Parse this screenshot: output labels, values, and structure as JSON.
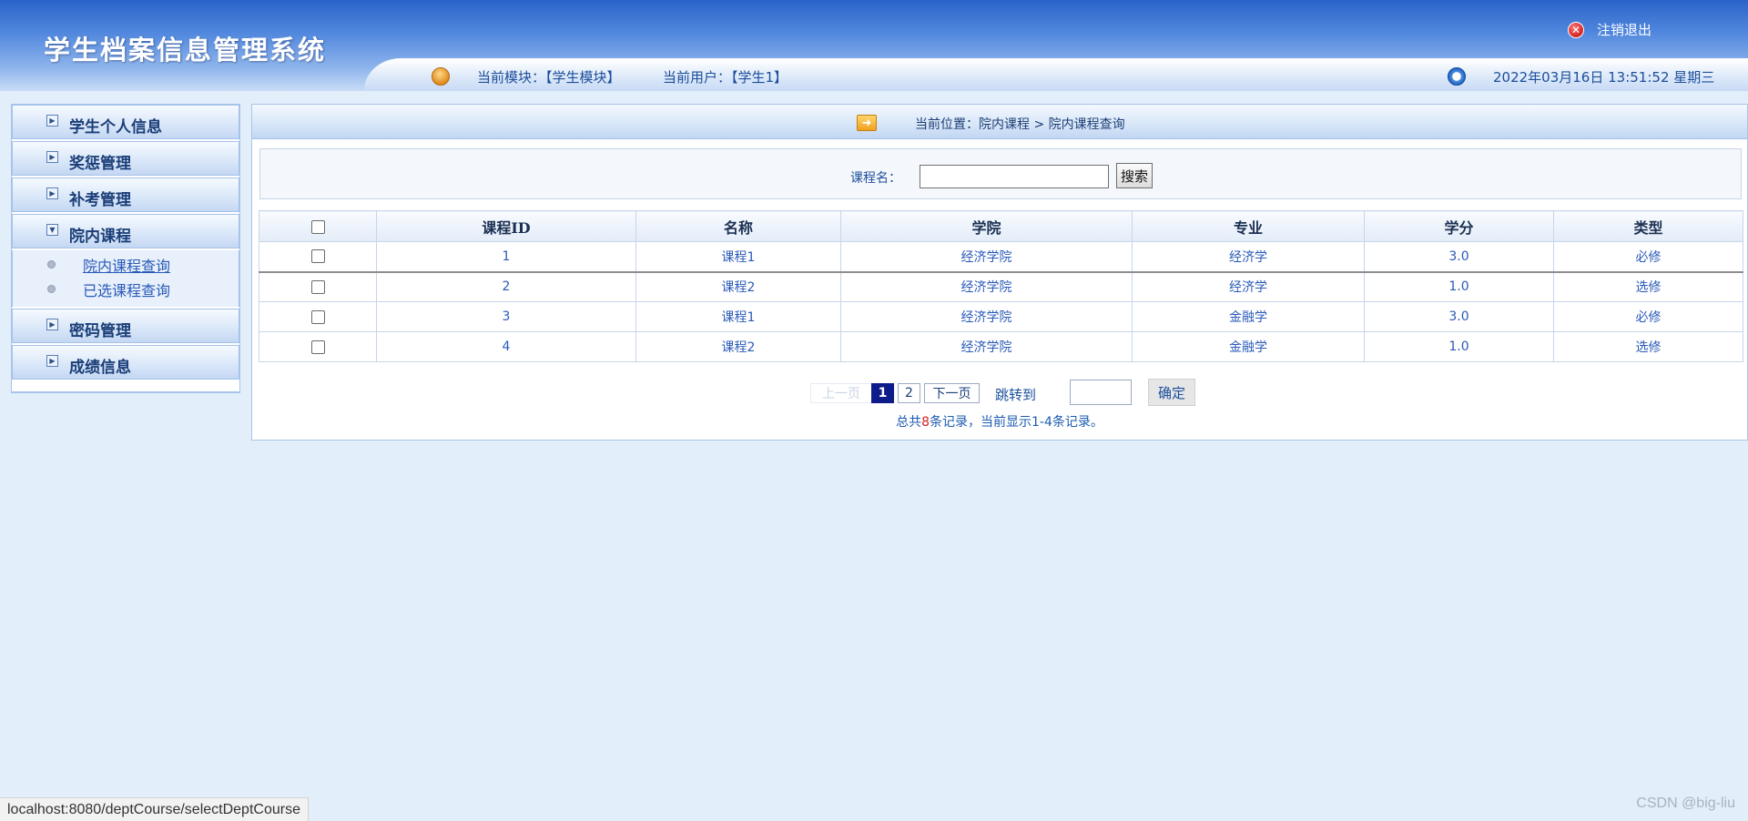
{
  "header": {
    "system_title": "学生档案信息管理系统",
    "logout_label": "注销退出",
    "module_text": "当前模块：【学生模块】",
    "user_text": "当前用户：【学生1】",
    "datetime_text": "2022年03月16日 13:51:52 星期三"
  },
  "sidebar": {
    "menus": [
      {
        "label": "学生个人信息"
      },
      {
        "label": "奖惩管理"
      },
      {
        "label": "补考管理"
      },
      {
        "label": "院内课程",
        "submenu": [
          "院内课程查询",
          "已选课程查询"
        ]
      },
      {
        "label": "密码管理"
      },
      {
        "label": "成绩信息"
      }
    ]
  },
  "breadcrumb": "当前位置：院内课程 > 院内课程查询",
  "search": {
    "label": "课程名：",
    "value": "",
    "button_label": "搜索"
  },
  "table": {
    "headers": [
      "课程ID",
      "名称",
      "学院",
      "专业",
      "学分",
      "类型"
    ],
    "rows": [
      [
        "1",
        "课程1",
        "经济学院",
        "经济学",
        "3.0",
        "必修"
      ],
      [
        "2",
        "课程2",
        "经济学院",
        "经济学",
        "1.0",
        "选修"
      ],
      [
        "3",
        "课程1",
        "经济学院",
        "金融学",
        "3.0",
        "必修"
      ],
      [
        "4",
        "课程2",
        "经济学院",
        "金融学",
        "1.0",
        "选修"
      ]
    ]
  },
  "pager": {
    "prev_label": "上一页",
    "pages": [
      "1",
      "2"
    ],
    "current_page": "1",
    "next_label": "下一页",
    "goto_label": "跳转到",
    "confirm_label": "确定",
    "summary_prefix": "总共",
    "summary_total": "8",
    "summary_suffix": "条记录，当前显示1-4条记录。"
  },
  "status_url": "localhost:8080/deptCourse/selectDeptCourse",
  "watermark": "CSDN @big-liu",
  "colors": {
    "header_dark": "#2a63c8",
    "link": "#2a5ab8",
    "active_page": "#0e1b8a",
    "total_count": "#e02020"
  }
}
